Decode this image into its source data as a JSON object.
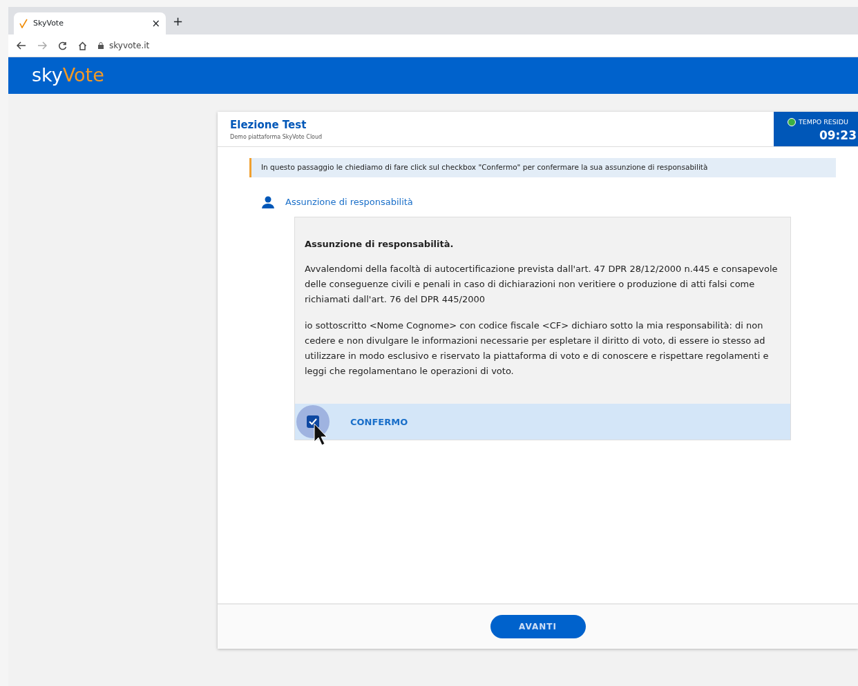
{
  "browser": {
    "tab_title": "SkyVote",
    "close": "×",
    "new_tab": "+",
    "url": "skyvote.it"
  },
  "header": {
    "logo_part1": "sky",
    "logo_part2": "Vote"
  },
  "election": {
    "title": "Elezione Test",
    "subtitle": "Demo piattaforma SkyVote Cloud"
  },
  "timer": {
    "label": "TEMPO RESIDU",
    "time": "09:23",
    "running": true
  },
  "notice": "In questo passaggio le chiediamo di fare click sul checkbox \"Confermo\" per confermare la sua assunzione di responsabilità",
  "section_title": "Assunzione di responsabilità",
  "declaration": {
    "heading": "Assunzione di responsabilità.",
    "paragraphs": [
      "Avvalendomi della facoltà di autocertificazione prevista dall'art. 47 DPR 28/12/2000 n.445 e consapevole delle conseguenze civili e penali in caso di dichiarazioni non veritiere o produzione di atti falsi come richiamati dall'art. 76 del DPR 445/2000",
      "io sottoscritto <Nome Cognome> con codice fiscale <CF> dichiaro sotto la mia responsabilità: di non cedere e non divulgare le informazioni necessarie per espletare il diritto di voto, di essere io stesso ad utilizzare in modo esclusivo e riservato la piattaforma di voto e di conoscere e rispettare regolamenti e leggi che regolamentano le operazioni di voto."
    ]
  },
  "confirm": {
    "label": "CONFERMO",
    "checked": true
  },
  "next_button": "AVANTI"
}
